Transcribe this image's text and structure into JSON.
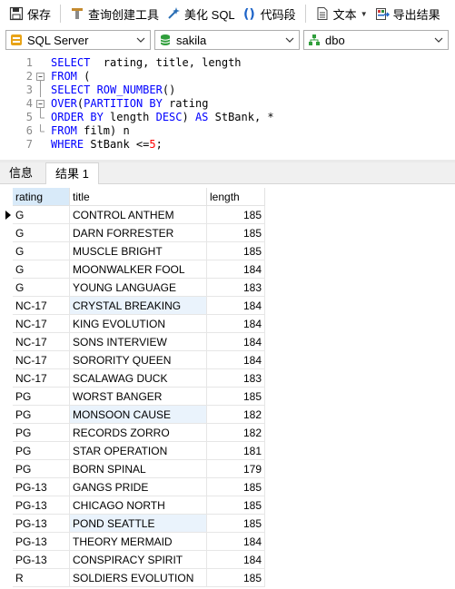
{
  "toolbar": {
    "save": "保存",
    "query_builder": "查询创建工具",
    "beautify": "美化 SQL",
    "snippet": "代码段",
    "text": "文本",
    "export": "导出结果"
  },
  "connection": {
    "server": "SQL Server",
    "database": "sakila",
    "schema": "dbo"
  },
  "editor": {
    "lines": [
      {
        "n": "1",
        "fold": "",
        "tokens": [
          [
            "kw",
            "SELECT"
          ],
          [
            "",
            "  rating, title, length"
          ]
        ]
      },
      {
        "n": "2",
        "fold": "box",
        "tokens": [
          [
            "kw",
            "FROM"
          ],
          [
            "",
            " ("
          ]
        ]
      },
      {
        "n": "3",
        "fold": "line",
        "tokens": [
          [
            "kw",
            "SELECT"
          ],
          [
            "kw",
            " ROW_NUMBER"
          ],
          [
            "",
            "()"
          ]
        ]
      },
      {
        "n": "4",
        "fold": "box",
        "tokens": [
          [
            "kw",
            "OVER"
          ],
          [
            "",
            "("
          ],
          [
            "kw",
            "PARTITION BY"
          ],
          [
            "",
            " rating"
          ]
        ]
      },
      {
        "n": "5",
        "fold": "end",
        "tokens": [
          [
            "kw",
            "ORDER BY"
          ],
          [
            "",
            " length "
          ],
          [
            "kw",
            "DESC"
          ],
          [
            "",
            ") "
          ],
          [
            "kw",
            "AS"
          ],
          [
            "",
            " StBank, *"
          ]
        ]
      },
      {
        "n": "6",
        "fold": "end",
        "tokens": [
          [
            "kw",
            "FROM"
          ],
          [
            "",
            " film) n"
          ]
        ]
      },
      {
        "n": "7",
        "fold": "",
        "tokens": [
          [
            "kw",
            "WHERE"
          ],
          [
            "",
            " StBank <="
          ],
          [
            "num",
            "5"
          ],
          [
            "",
            ";"
          ]
        ]
      }
    ]
  },
  "tabs": [
    {
      "label": "信息",
      "active": false
    },
    {
      "label": "结果 1",
      "active": true
    }
  ],
  "grid": {
    "columns": [
      "rating",
      "title",
      "length"
    ],
    "rows": [
      [
        "G",
        "CONTROL ANTHEM",
        "185"
      ],
      [
        "G",
        "DARN FORRESTER",
        "185"
      ],
      [
        "G",
        "MUSCLE BRIGHT",
        "185"
      ],
      [
        "G",
        "MOONWALKER FOOL",
        "184"
      ],
      [
        "G",
        "YOUNG LANGUAGE",
        "183"
      ],
      [
        "NC-17",
        "CRYSTAL BREAKING",
        "184"
      ],
      [
        "NC-17",
        "KING EVOLUTION",
        "184"
      ],
      [
        "NC-17",
        "SONS INTERVIEW",
        "184"
      ],
      [
        "NC-17",
        "SORORITY QUEEN",
        "184"
      ],
      [
        "NC-17",
        "SCALAWAG DUCK",
        "183"
      ],
      [
        "PG",
        "WORST BANGER",
        "185"
      ],
      [
        "PG",
        "MONSOON CAUSE",
        "182"
      ],
      [
        "PG",
        "RECORDS ZORRO",
        "182"
      ],
      [
        "PG",
        "STAR OPERATION",
        "181"
      ],
      [
        "PG",
        "BORN SPINAL",
        "179"
      ],
      [
        "PG-13",
        "GANGS PRIDE",
        "185"
      ],
      [
        "PG-13",
        "CHICAGO NORTH",
        "185"
      ],
      [
        "PG-13",
        "POND SEATTLE",
        "185"
      ],
      [
        "PG-13",
        "THEORY MERMAID",
        "184"
      ],
      [
        "PG-13",
        "CONSPIRACY SPIRIT",
        "184"
      ],
      [
        "R",
        "SOLDIERS EVOLUTION",
        "185"
      ]
    ],
    "current_row": 0,
    "highlighted_rows": [
      5,
      11,
      17
    ]
  }
}
